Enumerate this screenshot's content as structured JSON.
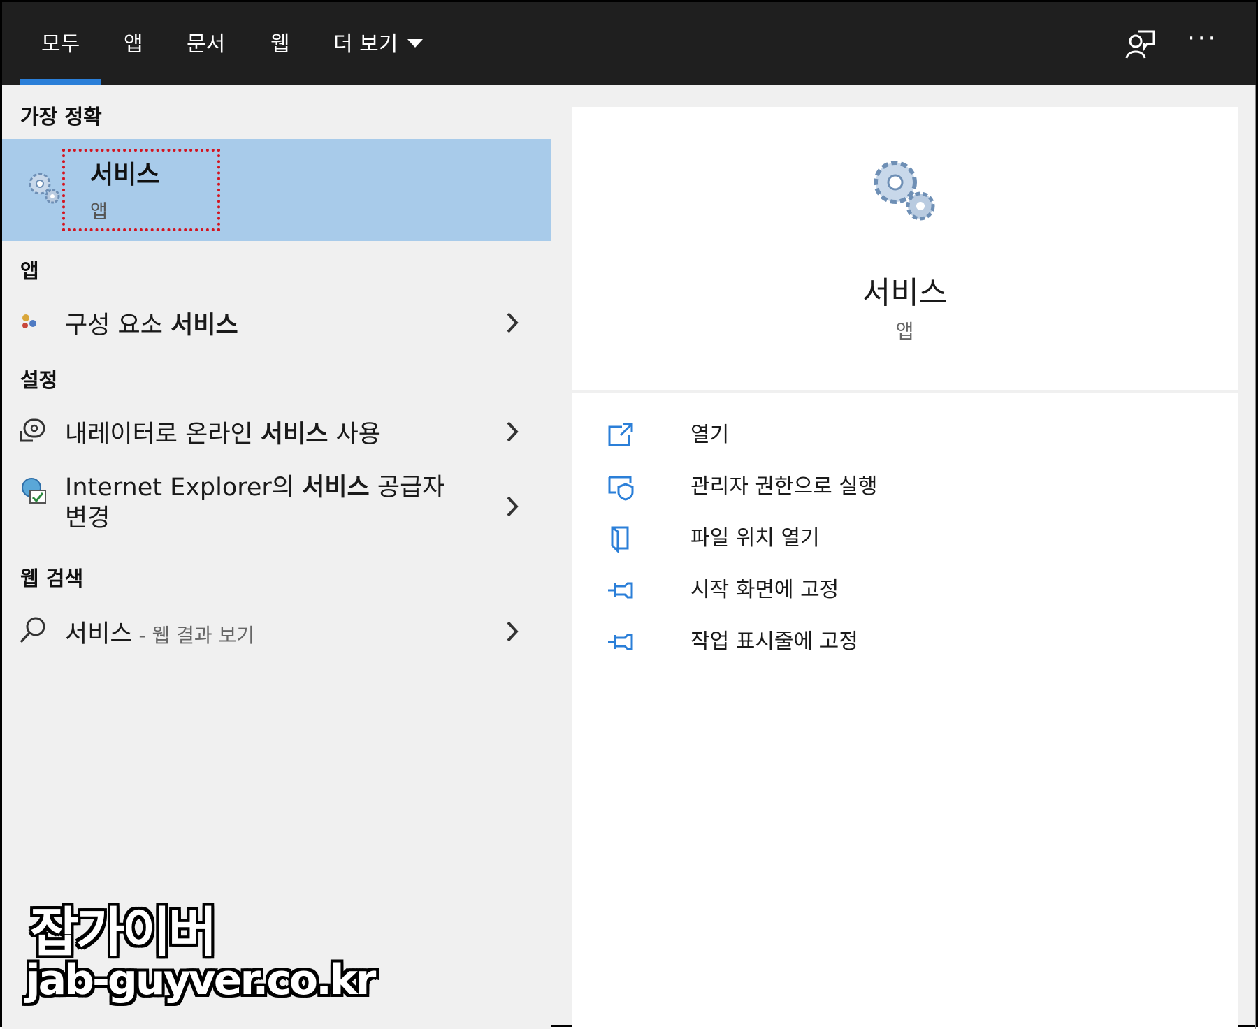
{
  "tabs": [
    {
      "label": "모두",
      "selected": true
    },
    {
      "label": "앱"
    },
    {
      "label": "문서"
    },
    {
      "label": "웹"
    },
    {
      "label": "더 보기"
    }
  ],
  "topbar": {
    "feedback_icon": "feedback-person-icon",
    "more_icon": "ellipsis-icon",
    "ellipsis": "···"
  },
  "sections": {
    "best_match": "가장 정확",
    "apps": "앱",
    "settings": "설정",
    "web_search": "웹 검색"
  },
  "best_match": {
    "title": "서비스",
    "subtitle": "앱"
  },
  "apps": [
    {
      "prefix": "구성 요소 ",
      "bold": "서비스",
      "suffix": ""
    }
  ],
  "settings": [
    {
      "prefix": "내레이터로 온라인 ",
      "bold": "서비스",
      "suffix": " 사용"
    },
    {
      "prefix": "Internet Explorer의 ",
      "bold": "서비스",
      "suffix": " 공급자",
      "line2": "변경"
    }
  ],
  "web": {
    "query": "서비스",
    "suffix": " - 웹 결과 보기"
  },
  "preview": {
    "title": "서비스",
    "subtitle": "앱"
  },
  "actions": [
    {
      "label": "열기",
      "icon": "open-icon"
    },
    {
      "label": "관리자 권한으로 실행",
      "icon": "shield-run-icon"
    },
    {
      "label": "파일 위치 열기",
      "icon": "file-location-icon"
    },
    {
      "label": "시작 화면에 고정",
      "icon": "pin-icon"
    },
    {
      "label": "작업 표시줄에 고정",
      "icon": "pin-icon"
    }
  ],
  "watermark": {
    "name": "잡가이버",
    "site": "jab-guyver.co.kr"
  },
  "colors": {
    "accent": "#2b7fd8",
    "selection": "#a8cbea",
    "topbar": "#1f1f1f",
    "highlight_box": "#d4141f"
  }
}
